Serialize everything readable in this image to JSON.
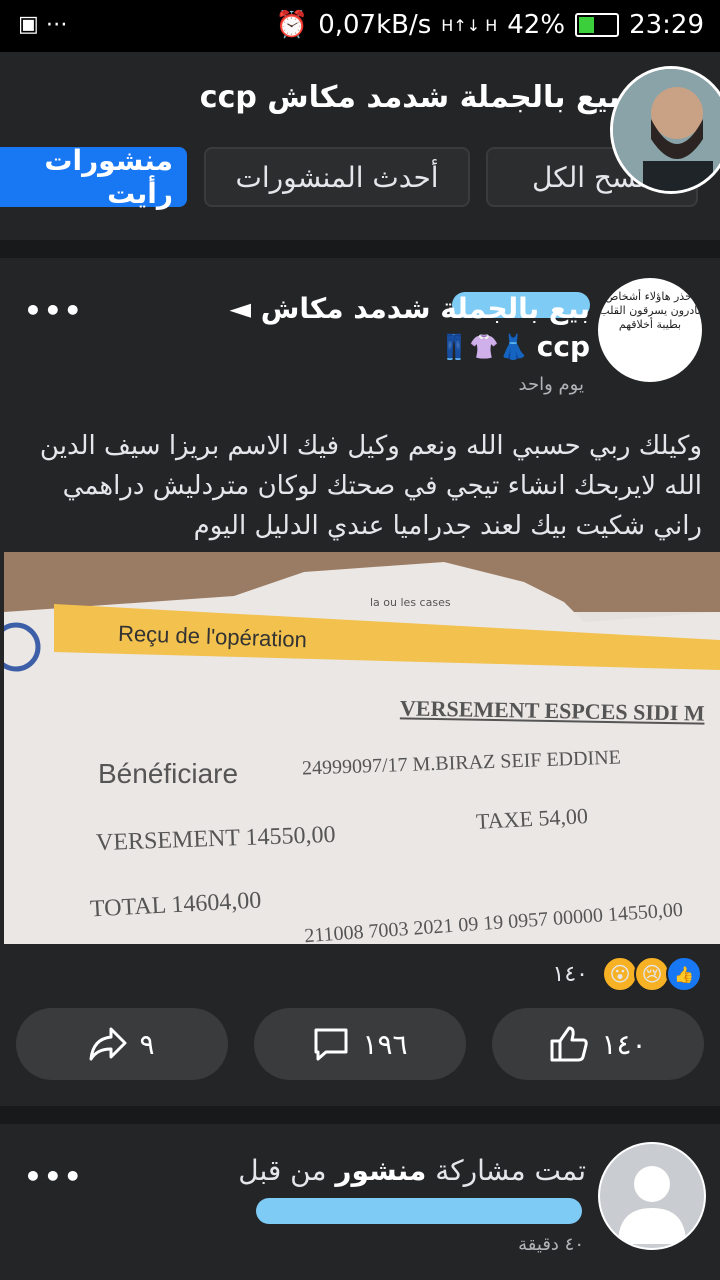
{
  "status_bar": {
    "notification_icons": "▣ ⋯",
    "alarm": "⏰",
    "speed": "0,07kB/s",
    "network": "H↑↓ H",
    "battery": "42%",
    "battery_level": 0.42,
    "time": "23:29"
  },
  "group": {
    "title": "بيع بالجملة شدمد مكاش ccp"
  },
  "tabs": [
    {
      "label": "مسح الكل",
      "active": false
    },
    {
      "label": "أحدث المنشورات",
      "active": false
    },
    {
      "label": "منشورات رأيت",
      "active": true
    }
  ],
  "post": {
    "avatar_text": "احذر هاؤلاء أشخاص نادرون يسرقون القلب بطيبة أخلاقهم",
    "arrow": "◄",
    "group_name": "بيع بالجملة شدمد مكاش",
    "group_name_suffix": "ccp",
    "emojis": "👖👚👗",
    "time": "يوم واحد",
    "body": "وكيلك ربي حسبي الله ونعم وكيل فيك الاسم بريزا سيف الدين الله لايربحك انشاء تيجي في صحتك لوكان متردليش دراهمي راني شكيت بيك لعند جدراميا عندي الدليل اليوم",
    "receipt": {
      "header_small": "la ou les cases",
      "title": "Reçu de l'opération",
      "operation": "VERSEMENT ESPCES SIDI M",
      "beneficiary_label": "Bénéficiare",
      "beneficiary_value": "24999097/17 M.BIRAZ SEIF EDDINE",
      "versement": "VERSEMENT 14550,00",
      "taxe": "TAXE 54,00",
      "total": "TOTAL 14604,00",
      "ref_line": "211008 7003 2021 09 19 0957 00000 14550,00"
    },
    "reaction_count": "١٤٠",
    "actions": {
      "share_count": "٩",
      "comment_count": "١٩٦",
      "like_count": "١٤٠"
    }
  },
  "post2": {
    "shared_prefix": "تمت مشاركة",
    "shared_bold": "منشور",
    "shared_suffix": "من قبل",
    "time": "٤٠ دقيقة"
  },
  "colors": {
    "accent": "#1877f2",
    "background": "#18191a",
    "card": "#242526",
    "redaction": "#7ecbf5"
  }
}
